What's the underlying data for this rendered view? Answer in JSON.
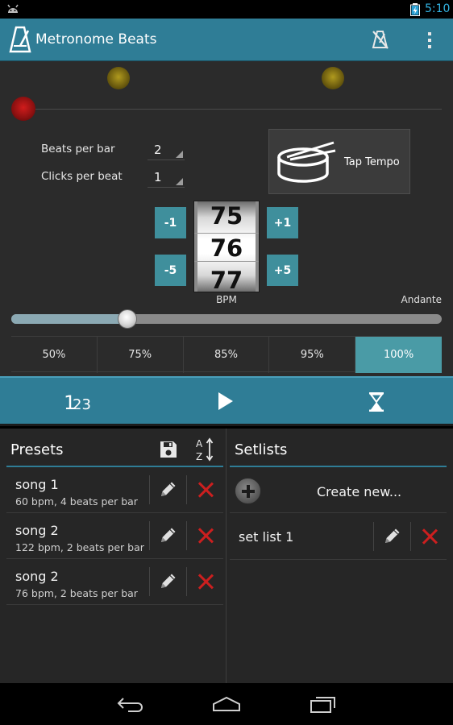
{
  "status": {
    "time": "5:10"
  },
  "app": {
    "title": "Metronome Beats"
  },
  "beats_per_bar": {
    "label": "Beats per bar",
    "value": "2"
  },
  "clicks_per_beat": {
    "label": "Clicks per beat",
    "value": "1"
  },
  "tap_tempo": {
    "label": "Tap Tempo"
  },
  "bpm": {
    "prev": "75",
    "current": "76",
    "next": "77",
    "label": "BPM",
    "tempo_name": "Andante",
    "slider_fraction": 0.27
  },
  "steps": {
    "minus1": "-1",
    "plus1": "+1",
    "minus5": "-5",
    "plus5": "+5"
  },
  "speed_presets": [
    {
      "label": "50%"
    },
    {
      "label": "75%"
    },
    {
      "label": "85%"
    },
    {
      "label": "95%"
    },
    {
      "label": "100%"
    }
  ],
  "speed_selected_index": 4,
  "controls": {
    "counter_label_1": "1",
    "counter_label_23": "23"
  },
  "presets": {
    "title": "Presets",
    "items": [
      {
        "name": "song 1",
        "desc": "60 bpm, 4 beats per bar"
      },
      {
        "name": "song 2",
        "desc": "122 bpm, 2 beats per bar"
      },
      {
        "name": "song 2",
        "desc": "76 bpm, 2 beats per bar"
      }
    ]
  },
  "setlists": {
    "title": "Setlists",
    "create_label": "Create new...",
    "items": [
      {
        "name": "set list 1"
      }
    ]
  },
  "colors": {
    "accent": "#2f7d96",
    "button": "#3f8f9c",
    "delete": "#cc1f1f"
  }
}
